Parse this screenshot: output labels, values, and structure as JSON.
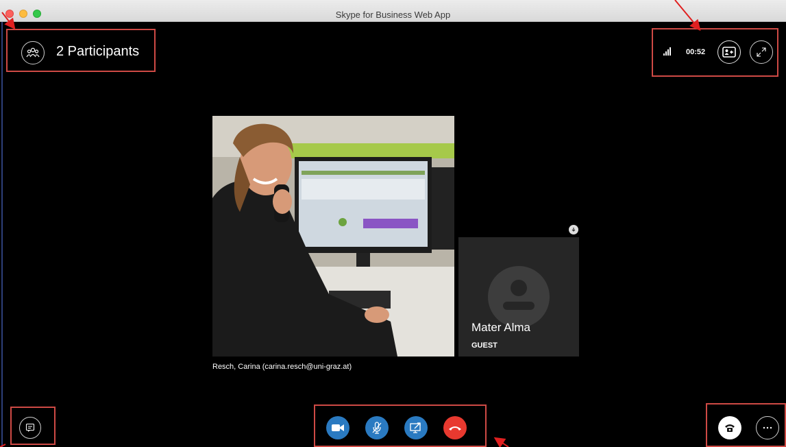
{
  "window": {
    "title": "Skype for Business Web App"
  },
  "header": {
    "participants_label": "2 Participants",
    "call_timer": "00:52"
  },
  "icons": {
    "participants": "participants-icon",
    "signal": "signal-strength-icon",
    "layout": "contact-card-layout-icon",
    "fullscreen": "expand-fullscreen-icon",
    "chat": "chat-icon",
    "video": "video-camera-icon",
    "mic": "microphone-muted-icon",
    "share": "screen-share-icon",
    "hangup": "hang-up-icon",
    "dialpad": "phone-dialpad-icon",
    "more": "more-options-icon",
    "pin": "pin-down-icon"
  },
  "video": {
    "main_caption": "Resch, Carina (carina.resch@uni-graz.at)"
  },
  "participant_tile": {
    "name": "Mater Alma",
    "role": "GUEST"
  },
  "colors": {
    "accent_blue": "#2a7ac1",
    "hangup_red": "#e8392f",
    "annotation_red": "#cf4a45"
  }
}
